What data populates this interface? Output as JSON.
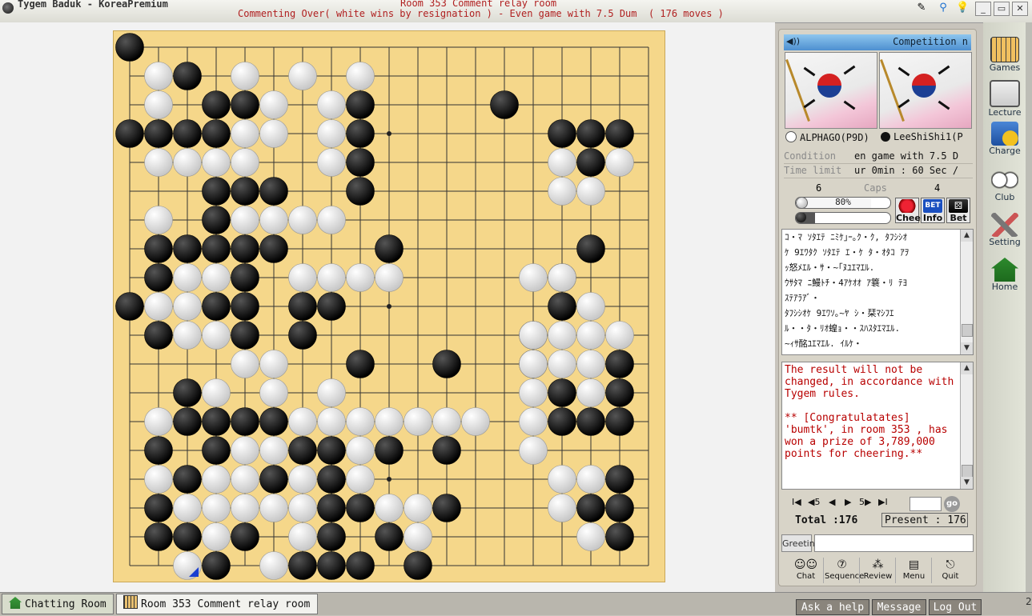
{
  "window": {
    "app_title": "Tygem Baduk - KoreaPremium",
    "title_line1": "Room 353 Comment relay room",
    "title_line2": "Commenting Over( white wins by resignation ) - Even game with 7.5 Dum  ( 176 moves )"
  },
  "board": {
    "size": 19,
    "black_stones": [
      "0,0",
      "1,2",
      "2,3",
      "2,4",
      "2,8",
      "2,13",
      "3,0",
      "3,1",
      "3,2",
      "3,3",
      "3,8",
      "3,15",
      "3,16",
      "3,17",
      "4,8",
      "4,16",
      "5,3",
      "5,4",
      "5,5",
      "5,8",
      "6,3",
      "7,1",
      "7,2",
      "7,3",
      "7,4",
      "7,5",
      "7,9",
      "7,16",
      "8,1",
      "8,4",
      "8,15",
      "9,0",
      "9,3",
      "9,4",
      "9,6",
      "9,7",
      "9,15",
      "10,1",
      "10,4",
      "10,6",
      "10,14",
      "11,8",
      "11,11",
      "11,14",
      "11,17",
      "12,2",
      "12,15",
      "12,17",
      "13,2",
      "13,3",
      "13,4",
      "13,5",
      "13,15",
      "13,16",
      "13,17",
      "14,1",
      "14,3",
      "14,6",
      "14,7",
      "14,9",
      "14,11",
      "15,2",
      "15,5",
      "15,7",
      "15,17",
      "16,1",
      "16,7",
      "16,8",
      "16,11",
      "16,16",
      "16,17",
      "17,1",
      "17,2",
      "17,4",
      "17,7",
      "17,9",
      "17,17",
      "18,3",
      "18,6",
      "18,7",
      "18,8",
      "18,10"
    ],
    "white_stones": [
      "1,1",
      "1,4",
      "1,6",
      "1,8",
      "2,1",
      "2,5",
      "2,7",
      "3,4",
      "3,5",
      "3,7",
      "4,1",
      "4,2",
      "4,3",
      "4,4",
      "4,7",
      "4,15",
      "4,17",
      "5,15",
      "5,16",
      "6,1",
      "6,4",
      "6,5",
      "6,6",
      "6,7",
      "8,2",
      "8,3",
      "8,6",
      "8,7",
      "8,8",
      "8,9",
      "8,14",
      "8,15",
      "9,1",
      "9,2",
      "9,16",
      "10,2",
      "10,3",
      "10,14",
      "10,15",
      "10,16",
      "10,17",
      "11,4",
      "11,5",
      "11,14",
      "11,15",
      "11,16",
      "12,3",
      "12,5",
      "12,7",
      "12,14",
      "12,16",
      "13,1",
      "13,6",
      "13,7",
      "13,8",
      "13,9",
      "13,10",
      "13,11",
      "13,12",
      "13,14",
      "14,4",
      "14,5",
      "14,8",
      "14,14",
      "15,1",
      "15,3",
      "15,4",
      "15,6",
      "15,8",
      "15,15",
      "15,16",
      "16,2",
      "16,3",
      "16,4",
      "16,5",
      "16,6",
      "16,9",
      "16,10",
      "16,15",
      "17,3",
      "17,6",
      "17,10",
      "17,16",
      "18,2",
      "18,5"
    ],
    "last_move": "18,2"
  },
  "competition": {
    "header_label": "Competition n",
    "speaker_glyph": "◀))",
    "white_player": "ALPHAGO(P9D)",
    "black_player": "LeeShiShi1(P",
    "condition_label": "Condition",
    "condition_value": "en game with 7.5 D",
    "time_label": "Time limit",
    "time_value": "ur 0min : 60 Sec /",
    "caps_label": "Caps",
    "white_caps": "6",
    "black_caps": "4",
    "white_percent": "80%",
    "black_percent": "20%",
    "white_fraction": 0.8,
    "black_fraction": 0.2,
    "cheer_label": "Cheer",
    "info_label": "Info",
    "bet_label": "Bet",
    "bet_badge": "BET"
  },
  "chat_lines": [
    "ｺ・ﾏ ｿﾀｴﾃ ﾆﾐｹ｣ｰ｡ｸ・ｸ, ﾀﾌｼｼｵ",
    "ｹ 9ｴﾜﾀｸ ｿﾀｴﾃ ｴ・ｹ ﾀ・ｵﾀｺ ｱｦ",
    "ｯ怒ﾒｴﾙ・ｻ・~｢ﾇﾕｴﾏｴﾙ.",
    "ｳｻﾀﾏ ﾆ鰻ﾄﾁ・4ｱｹｵｵ ｱ簔・ﾘ ﾃﾖ",
    "ｽﾃｱﾗｱﾞ・",
    "ﾀﾌｼｼｵｹ 9ｴﾜｿ｡~ﾔ ｼ・栞ﾏｼﾌｴ",
    "ﾙ・・ﾀ・ﾘｵ蝗ｮ・・ｽﾊｽﾀｴﾏｴﾙ.",
    "~ｨｻ酩ﾕｴﾏｴﾙ. ｲﾙｹ・"
  ],
  "system_message": "The result will not be changed, in accordance with Tygem rules.\n\n** [Congratulatates] 'bumtk', in room 353 , has won a prize of 3,789,000 points for cheering.**",
  "navigation": {
    "first": "I◀",
    "back5": "◀5",
    "prev": "◀",
    "next": "▶",
    "fwd5": "5▶",
    "last": "▶I",
    "go_label": "go",
    "total_text": "Total :176",
    "present_text": "Present : 176"
  },
  "greeting": {
    "label": "Greeting",
    "value": ""
  },
  "tools": [
    {
      "label": "Chat",
      "glyph": "☺☺"
    },
    {
      "label": "Sequence",
      "glyph": "⑦"
    },
    {
      "label": "Review",
      "glyph": "⁂"
    },
    {
      "label": "Menu",
      "glyph": "▤"
    },
    {
      "label": "Quit",
      "glyph": "⎋"
    }
  ],
  "sidebar": {
    "games": "Games",
    "lecture": "Lecture",
    "charge": "Charge",
    "club": "Club",
    "setting": "Setting",
    "home": "Home"
  },
  "bottom": {
    "tab_chatting": "Chatting Room",
    "tab_room": "Room 353 Comment relay room",
    "ask_help": "Ask a help",
    "message": "Message",
    "logout": "Log Out",
    "edge_digit": "2"
  },
  "colors": {
    "board": "#f5d78a",
    "title_text": "#b02020",
    "system_text": "#b80000",
    "header_blue": "#4d8fd0"
  }
}
